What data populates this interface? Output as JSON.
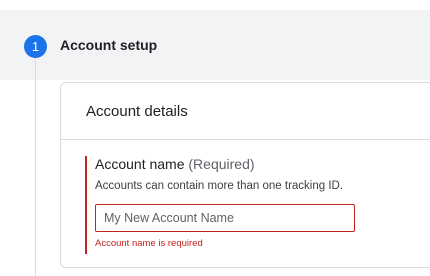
{
  "step": {
    "number": "1",
    "title": "Account setup"
  },
  "card": {
    "title": "Account details"
  },
  "account_name": {
    "label": "Account name",
    "required_text": "(Required)",
    "help_text": "Accounts can contain more than one tracking ID.",
    "placeholder": "My New Account Name",
    "value": "",
    "error_text": "Account name is required"
  },
  "colors": {
    "step_circle": "#1a73e8",
    "error": "#c5221f",
    "header_band": "#f1f3f4",
    "border": "#dadce0"
  }
}
